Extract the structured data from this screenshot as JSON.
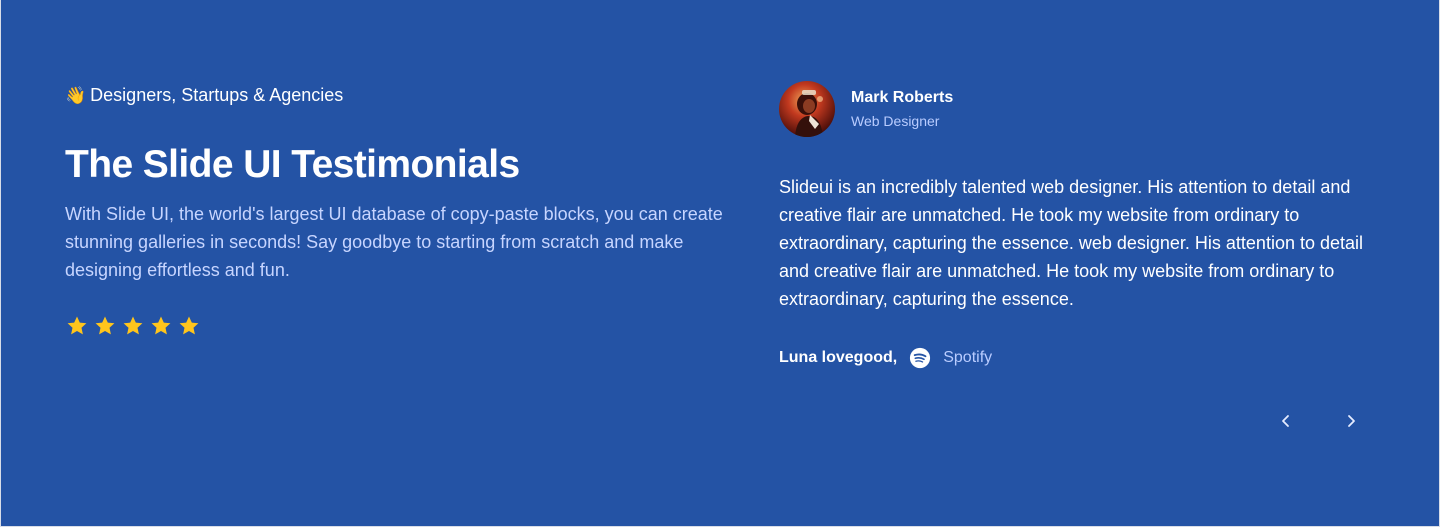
{
  "colors": {
    "background": "#2453a5",
    "star": "#ffc51c",
    "muted_text": "#c7d5ff"
  },
  "intro": {
    "eyebrow_emoji": "👋",
    "eyebrow": "Designers, Startups & Agencies",
    "title": "The Slide UI Testimonials",
    "description": "With Slide UI, the world's largest UI database of copy-paste blocks, you can create stunning galleries in seconds! Say goodbye to starting from scratch and make designing effortless and fun.",
    "rating": 5,
    "rating_icon": "star-icon"
  },
  "testimonial": {
    "author_name": "Mark Roberts",
    "author_role": "Web Designer",
    "quote": "Slideui is an incredibly talented web designer. His attention to detail and creative flair are unmatched. He took my website from ordinary to extraordinary, capturing the essence. web designer. His attention to detail and creative flair are unmatched. He took my website from ordinary to extraordinary, capturing the essence.",
    "source_name": "Luna lovegood,",
    "source_icon": "spotify-icon",
    "source_brand": "Spotify"
  },
  "navigation": {
    "prev_icon": "chevron-left-icon",
    "next_icon": "chevron-right-icon"
  }
}
